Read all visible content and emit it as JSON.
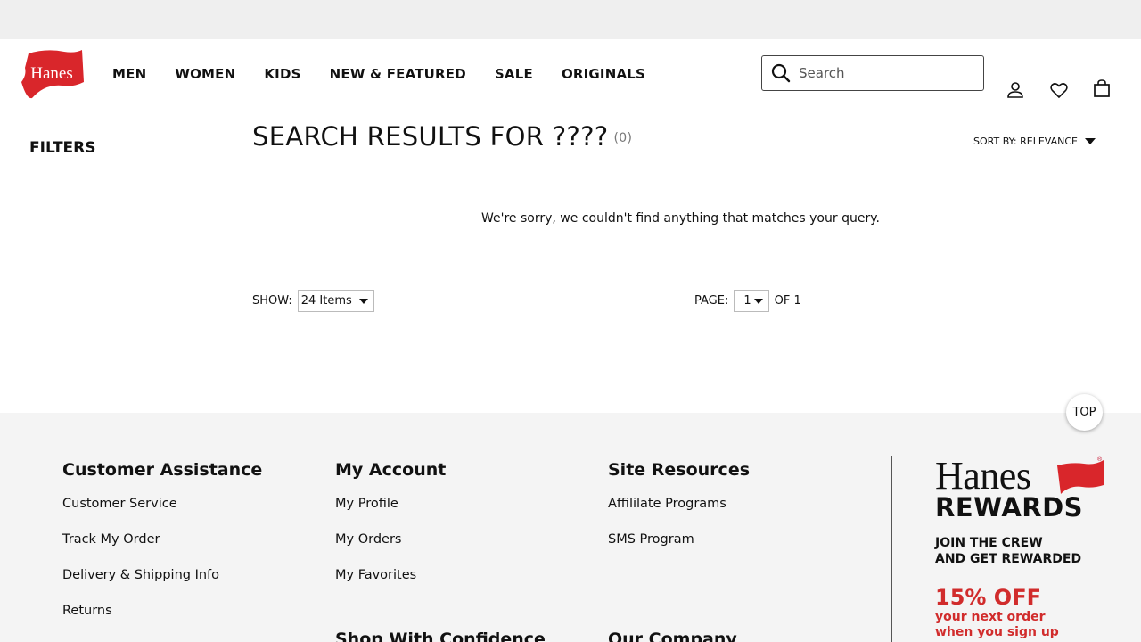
{
  "header": {
    "logo_text": "Hanes",
    "nav": [
      "MEN",
      "WOMEN",
      "KIDS",
      "NEW & FEATURED",
      "SALE",
      "ORIGINALS"
    ],
    "search_placeholder": "Search",
    "icons": [
      "account-icon",
      "heart-icon",
      "bag-icon"
    ]
  },
  "filters": {
    "title": "FILTERS"
  },
  "results": {
    "title": "SEARCH RESULTS FOR ????",
    "count": "(0)",
    "sort_label": "SORT BY: RELEVANCE",
    "empty_message": "We're sorry, we couldn't find anything that matches your query.",
    "show_label": "SHOW:",
    "show_value": "24 Items",
    "page_label": "PAGE:",
    "page_value": "1",
    "page_of": "OF 1"
  },
  "top_button": "TOP",
  "footer": {
    "columns": [
      {
        "title": "Customer Assistance",
        "links": [
          "Customer Service",
          "Track My Order",
          "Delivery & Shipping Info",
          "Returns"
        ]
      },
      {
        "title": "My Account",
        "links": [
          "My Profile",
          "My Orders",
          "My Favorites"
        ],
        "subheading": "Shop With Confidence"
      },
      {
        "title": "Site Resources",
        "links": [
          "Affililate Programs",
          "SMS Program"
        ],
        "subheading": "Our Company"
      }
    ],
    "rewards": {
      "brand": "Hanes",
      "program": "REWARDS",
      "join_line1": "JOIN THE CREW",
      "join_line2": "AND GET REWARDED",
      "offer": "15% OFF",
      "offer_sub1": "your next order",
      "offer_sub2": "when you sign up",
      "brand_color": "#d12c2c"
    }
  }
}
